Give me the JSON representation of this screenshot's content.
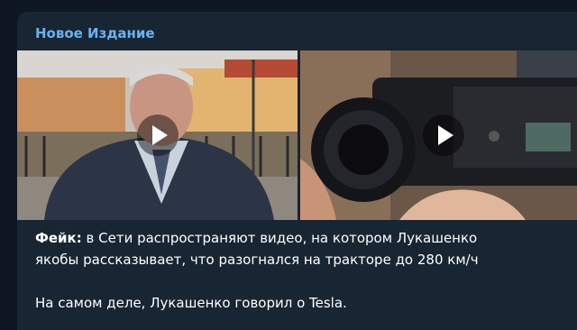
{
  "channel": {
    "name": "Новое Издание"
  },
  "media": [
    {
      "play_icon": "play-icon"
    },
    {
      "play_icon": "play-icon"
    }
  ],
  "message": {
    "fake_label": "Фейк:",
    "line1_rest": " в Сети распространяют видео, на котором Лукашенко",
    "line2": "якобы рассказывает, что разогнался на тракторе до 280 км/ч",
    "paragraph2": "На самом деле, Лукашенко говорил о Tesla."
  },
  "colors": {
    "background": "#0e1621",
    "bubble": "#182533",
    "channel_name": "#6ab2f2",
    "text": "#ffffff"
  }
}
